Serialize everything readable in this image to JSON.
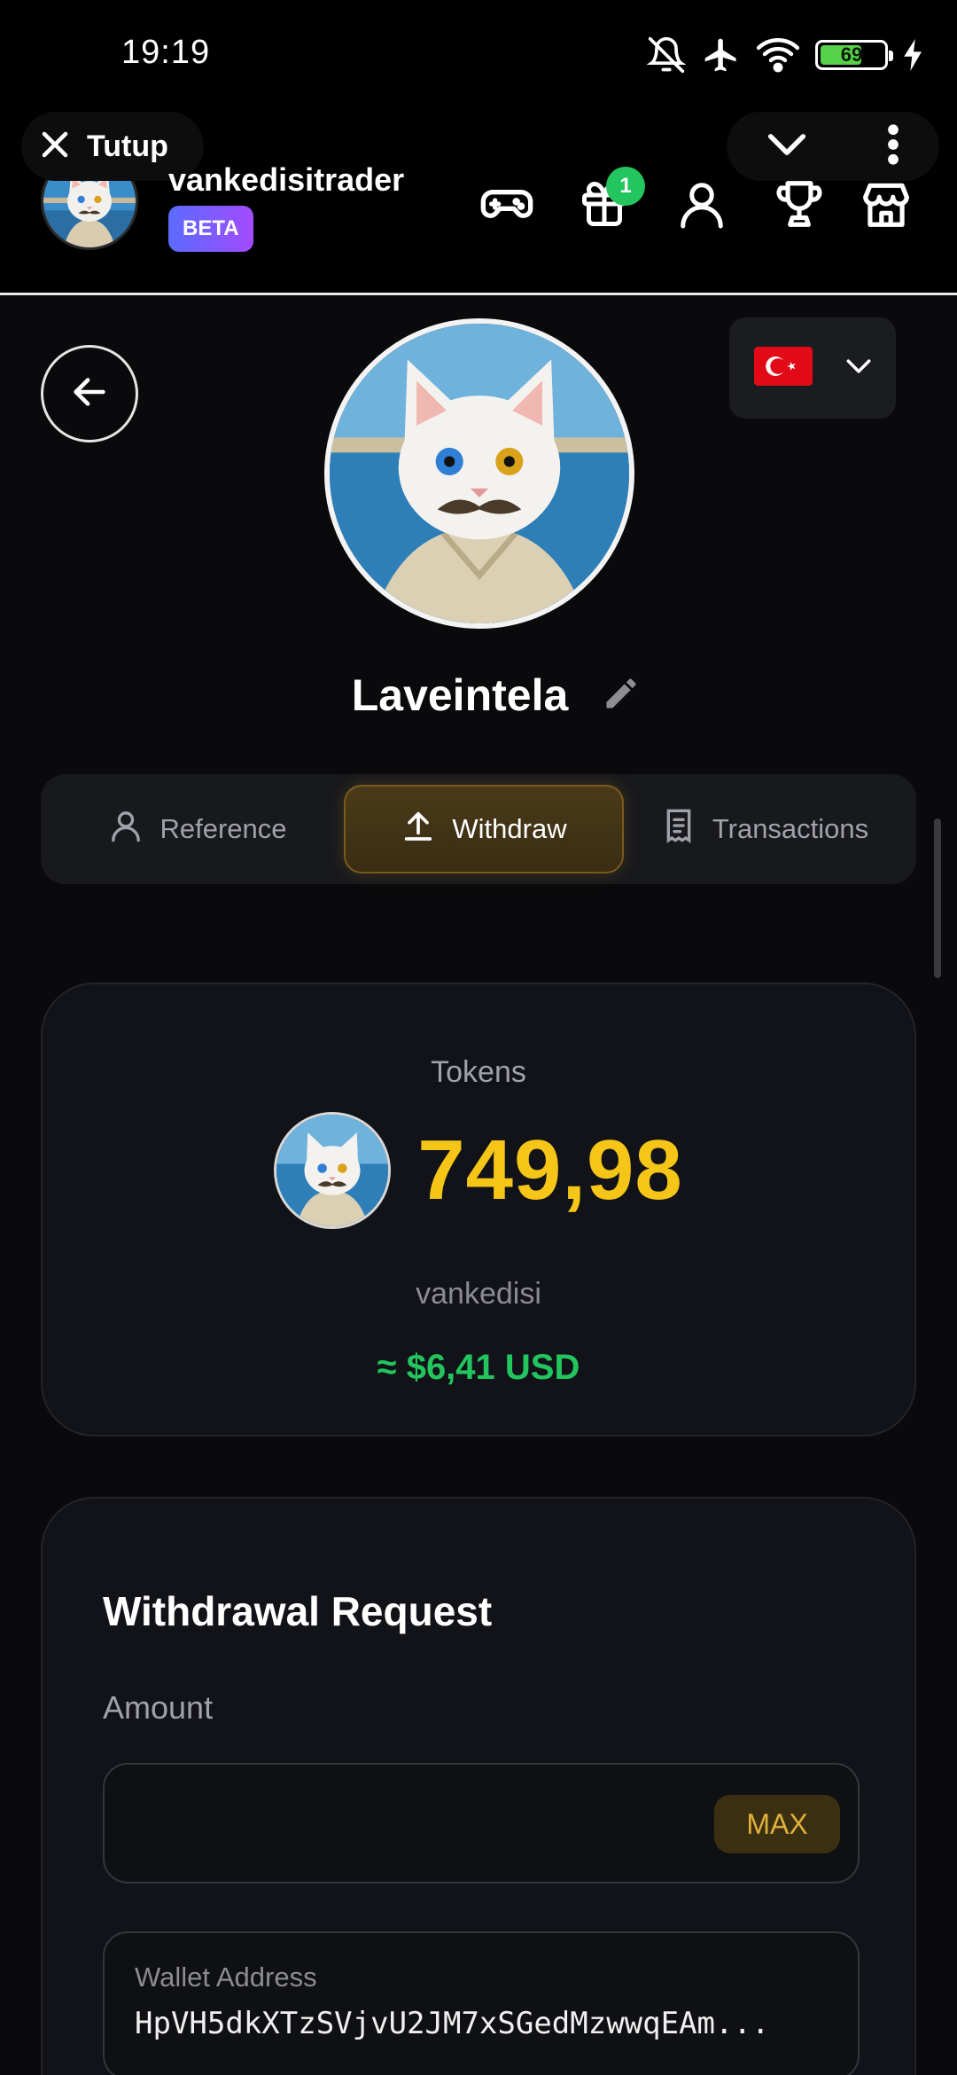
{
  "status_bar": {
    "time": "19:19",
    "battery_level": "69",
    "icons": [
      "mute-icon",
      "airplane-mode-icon",
      "wifi-icon",
      "battery-icon",
      "charging-icon"
    ]
  },
  "miniapp": {
    "close_label": "Tutup",
    "username": "vankedisitrader",
    "badge": "BETA",
    "gift_count": "1",
    "nav_icons": [
      "gamepad-icon",
      "gift-icon",
      "user-icon",
      "trophy-icon",
      "store-icon"
    ]
  },
  "profile": {
    "name": "Laveintela",
    "language_flag": "🇹🇷"
  },
  "tabs": [
    {
      "label": "Reference",
      "icon": "user-icon",
      "active": false
    },
    {
      "label": "Withdraw",
      "icon": "upload-icon",
      "active": true
    },
    {
      "label": "Transactions",
      "icon": "receipt-icon",
      "active": false
    }
  ],
  "tokens": {
    "label": "Tokens",
    "amount": "749,98",
    "token_name": "vankedisi",
    "usd_value": "≈ $6,41 USD"
  },
  "withdraw": {
    "title": "Withdrawal Request",
    "amount_label": "Amount",
    "amount_value": "",
    "max_label": "MAX",
    "wallet_label": "Wallet Address",
    "wallet_value": "HpVH5dkXTzSVjvU2JM7xSGedMzwwqEAm..."
  },
  "colors": {
    "accent_gold": "#f5c518",
    "usd_green": "#22c55e",
    "badge_gradient": "#5b6cff",
    "card_bg": "#121318"
  }
}
